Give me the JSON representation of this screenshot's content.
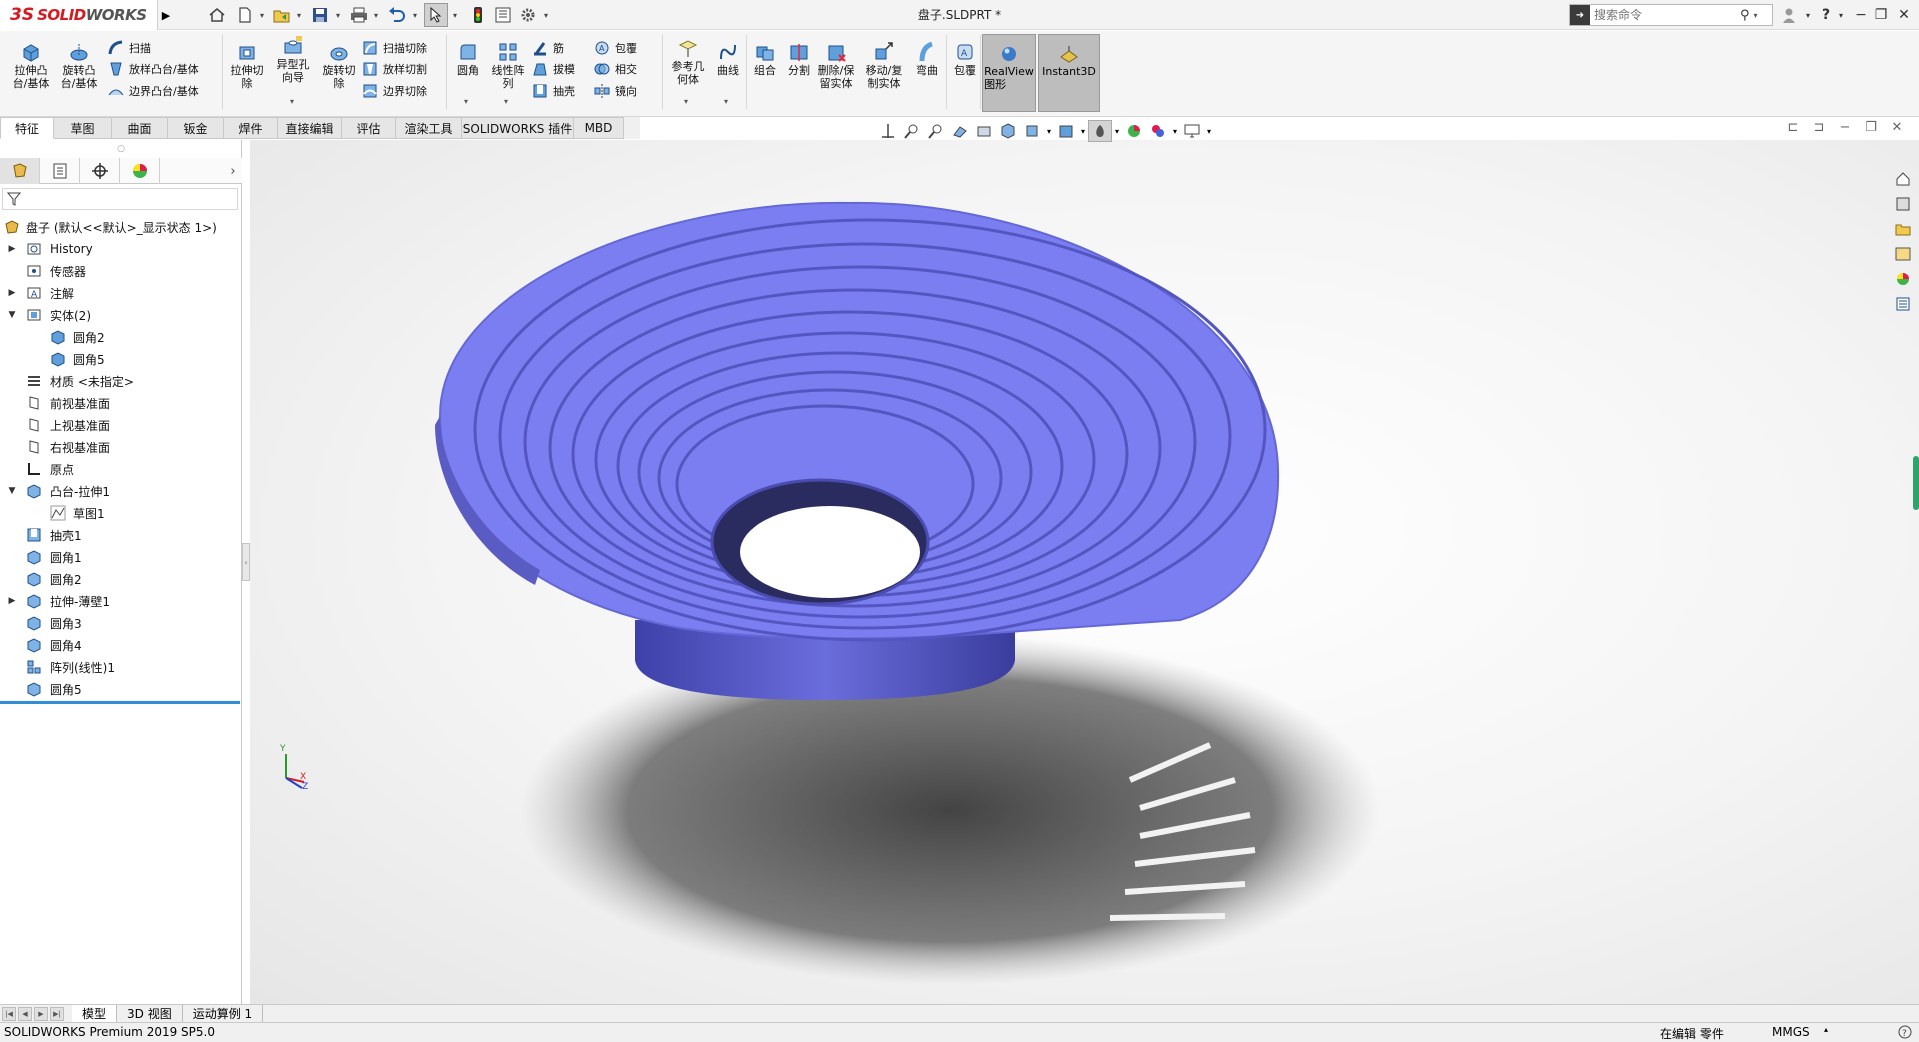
{
  "app": {
    "logo_ds": "3S",
    "logo_solid": "SOLID",
    "logo_works": "WORKS",
    "doc_title": "盘子.SLDPRT *"
  },
  "search": {
    "placeholder": "搜索命令"
  },
  "ribbon": {
    "extrude_boss": "拉伸凸\n台/基体",
    "revolve_boss": "旋转凸\n台/基体",
    "sweep": "扫描",
    "loft": "放样凸台/基体",
    "boundary": "边界凸台/基体",
    "extrude_cut": "拉伸切\n除",
    "hole_wizard": "异型孔\n向导",
    "revolve_cut": "旋转切\n除",
    "sweep_cut": "扫描切除",
    "loft_cut": "放样切割",
    "boundary_cut": "边界切除",
    "fillet": "圆角",
    "linear_pattern": "线性阵\n列",
    "rib": "筋",
    "draft": "拔模",
    "shell": "抽壳",
    "wrap": "包覆",
    "intersect": "相交",
    "mirror": "镜向",
    "ref_geometry": "参考几\n何体",
    "curves": "曲线",
    "combine": "组合",
    "split": "分割",
    "delete_keep_body": "删除/保\n留实体",
    "move_copy_body": "移动/复\n制实体",
    "flex": "弯曲",
    "wrap2": "包覆",
    "realview": "RealView\n图形",
    "instant3d": "Instant3D"
  },
  "tabs": [
    "特征",
    "草图",
    "曲面",
    "钣金",
    "焊件",
    "直接编辑",
    "评估",
    "渲染工具",
    "SOLIDWORKS 插件",
    "MBD"
  ],
  "tree": {
    "root": "盘子  (默认<<默认>_显示状态 1>)",
    "items": [
      "History",
      "传感器",
      "注解",
      "实体(2)",
      "圆角2",
      "圆角5",
      "材质 <未指定>",
      "前视基准面",
      "上视基准面",
      "右视基准面",
      "原点",
      "凸台-拉伸1",
      "草图1",
      "抽壳1",
      "圆角1",
      "圆角2",
      "拉伸-薄壁1",
      "圆角3",
      "圆角4",
      "阵列(线性)1",
      "圆角5"
    ]
  },
  "bottom_tabs": [
    "模型",
    "3D 视图",
    "运动算例 1"
  ],
  "status": {
    "product": "SOLIDWORKS Premium 2019 SP5.0",
    "mode": "在编辑 零件",
    "units": "MMGS"
  },
  "triad": {
    "x": "X",
    "y": "Y",
    "z": "Z"
  },
  "colors": {
    "model": "#7b7ef0",
    "logo": "#d71920",
    "accent": "#2f8fd6"
  }
}
